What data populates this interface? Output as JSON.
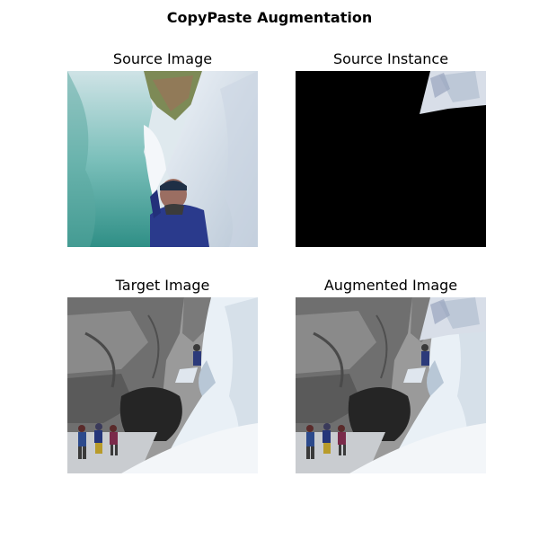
{
  "figure": {
    "title": "CopyPaste Augmentation"
  },
  "panels": [
    {
      "title": "Source Image",
      "image": "photo-ice-canyon-person"
    },
    {
      "title": "Source Instance",
      "image": "mask-ice-fragment-on-black"
    },
    {
      "title": "Target Image",
      "image": "photo-ice-climbing-canyon"
    },
    {
      "title": "Augmented Image",
      "image": "photo-ice-canyon-with-pasted-instance"
    }
  ],
  "colors": {
    "mask_background": "#000000",
    "ice_light": "#e8eef4",
    "ice_teal": "#4fa39b",
    "rock_gray": "#6f6f6f",
    "jacket_blue": "#2a3a8c"
  }
}
